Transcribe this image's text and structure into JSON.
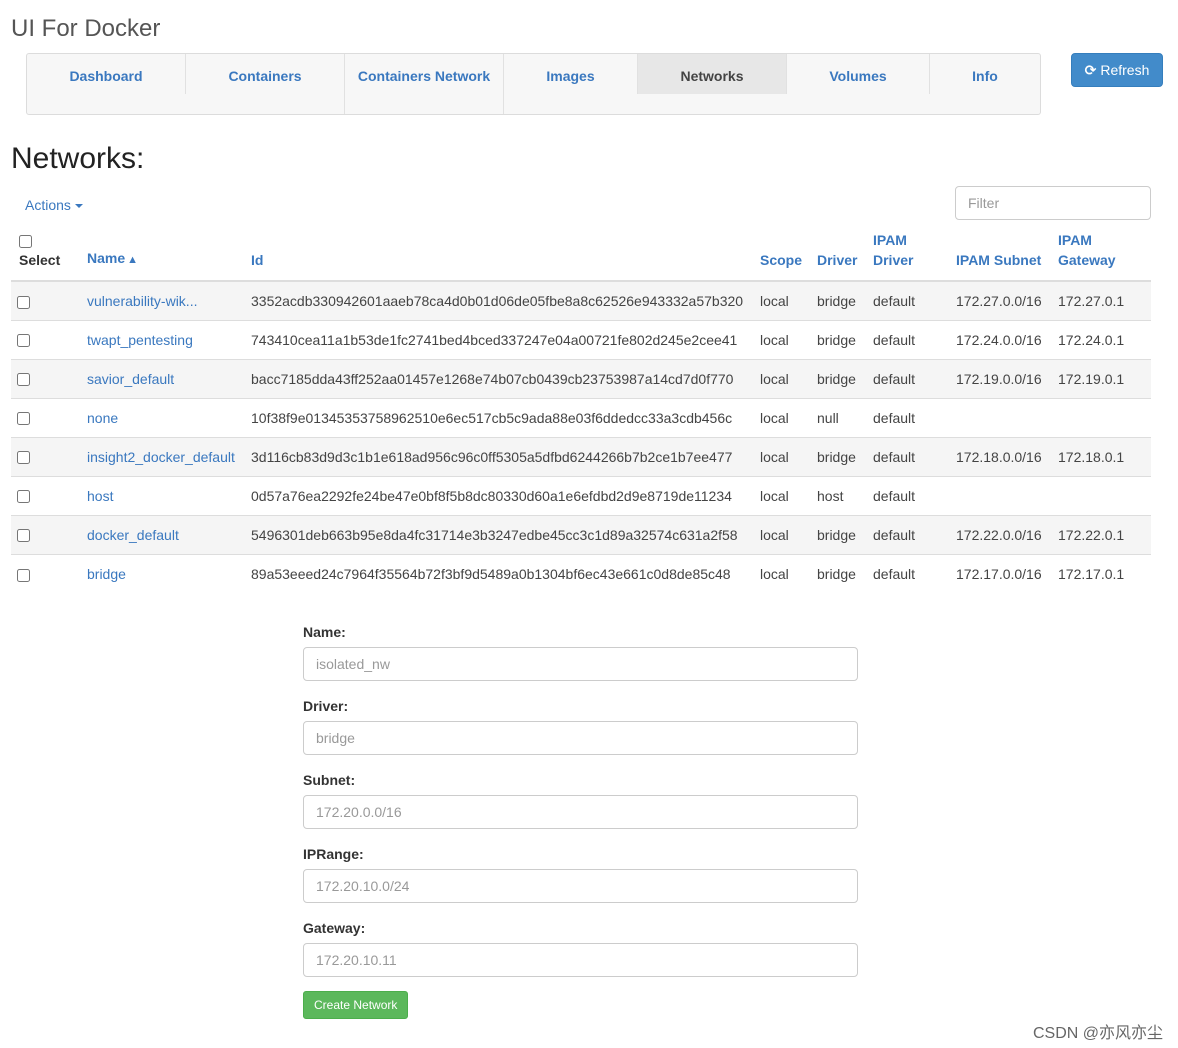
{
  "app": {
    "title": "UI For Docker"
  },
  "nav": {
    "items": [
      {
        "label": "Dashboard"
      },
      {
        "label": "Containers"
      },
      {
        "label": "Containers Network"
      },
      {
        "label": "Images"
      },
      {
        "label": "Networks",
        "active": true
      },
      {
        "label": "Volumes"
      },
      {
        "label": "Info"
      }
    ]
  },
  "toolbar": {
    "refresh_label": "Refresh",
    "refresh_icon": "refresh-icon"
  },
  "page": {
    "title": "Networks:"
  },
  "actions": {
    "label": "Actions"
  },
  "filter": {
    "placeholder": "Filter",
    "value": ""
  },
  "table": {
    "headers": {
      "select": "Select",
      "name": "Name",
      "id": "Id",
      "scope": "Scope",
      "driver": "Driver",
      "ipam_driver": "IPAM Driver",
      "ipam_subnet": "IPAM Subnet",
      "ipam_gateway": "IPAM Gateway"
    },
    "sort_icon": "chevron-up-icon",
    "rows": [
      {
        "name": "vulnerability-wik...",
        "id": "3352acdb330942601aaeb78ca4d0b01d06de05fbe8a8c62526e943332a57b320",
        "scope": "local",
        "driver": "bridge",
        "ipam_driver": "default",
        "subnet": "172.27.0.0/16",
        "gateway": "172.27.0.1"
      },
      {
        "name": "twapt_pentesting",
        "id": "743410cea11a1b53de1fc2741bed4bced337247e04a00721fe802d245e2cee41",
        "scope": "local",
        "driver": "bridge",
        "ipam_driver": "default",
        "subnet": "172.24.0.0/16",
        "gateway": "172.24.0.1"
      },
      {
        "name": "savior_default",
        "id": "bacc7185dda43ff252aa01457e1268e74b07cb0439cb23753987a14cd7d0f770",
        "scope": "local",
        "driver": "bridge",
        "ipam_driver": "default",
        "subnet": "172.19.0.0/16",
        "gateway": "172.19.0.1"
      },
      {
        "name": "none",
        "id": "10f38f9e01345353758962510e6ec517cb5c9ada88e03f6ddedcc33a3cdb456c",
        "scope": "local",
        "driver": "null",
        "ipam_driver": "default",
        "subnet": "",
        "gateway": ""
      },
      {
        "name": "insight2_docker_default",
        "id": "3d116cb83d9d3c1b1e618ad956c96c0ff5305a5dfbd6244266b7b2ce1b7ee477",
        "scope": "local",
        "driver": "bridge",
        "ipam_driver": "default",
        "subnet": "172.18.0.0/16",
        "gateway": "172.18.0.1"
      },
      {
        "name": "host",
        "id": "0d57a76ea2292fe24be47e0bf8f5b8dc80330d60a1e6efdbd2d9e8719de11234",
        "scope": "local",
        "driver": "host",
        "ipam_driver": "default",
        "subnet": "",
        "gateway": ""
      },
      {
        "name": "docker_default",
        "id": "5496301deb663b95e8da4fc31714e3b3247edbe45cc3c1d89a32574c631a2f58",
        "scope": "local",
        "driver": "bridge",
        "ipam_driver": "default",
        "subnet": "172.22.0.0/16",
        "gateway": "172.22.0.1"
      },
      {
        "name": "bridge",
        "id": "89a53eeed24c7964f35564b72f3bf9d5489a0b1304bf6ec43e661c0d8de85c48",
        "scope": "local",
        "driver": "bridge",
        "ipam_driver": "default",
        "subnet": "172.17.0.0/16",
        "gateway": "172.17.0.1"
      }
    ]
  },
  "form": {
    "name_label": "Name:",
    "name_placeholder": "isolated_nw",
    "driver_label": "Driver:",
    "driver_placeholder": "bridge",
    "subnet_label": "Subnet:",
    "subnet_placeholder": "172.20.0.0/16",
    "iprange_label": "IPRange:",
    "iprange_placeholder": "172.20.10.0/24",
    "gateway_label": "Gateway:",
    "gateway_placeholder": "172.20.10.11",
    "submit_label": "Create Network"
  },
  "watermark": {
    "text": "CSDN @亦风亦尘"
  },
  "colors": {
    "link": "#3a78bf",
    "primary": "#428bca",
    "success": "#5cb85c",
    "stripe": "#f5f5f5"
  }
}
